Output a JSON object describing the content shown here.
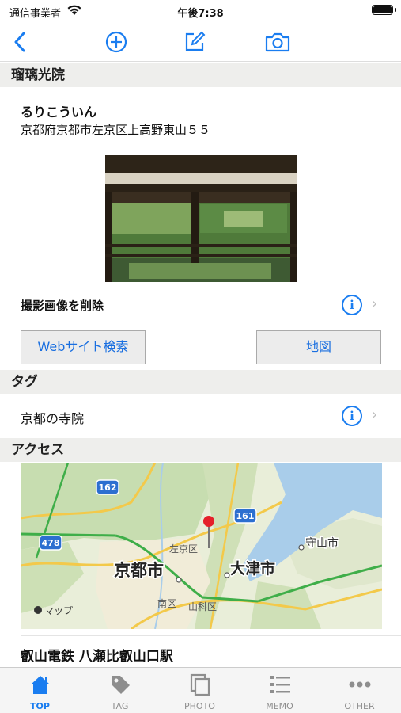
{
  "status_bar": {
    "carrier": "通信事業者",
    "time": "午後7:38"
  },
  "place": {
    "name": "瑠璃光院",
    "kana": "るりこういん",
    "address": "京都府京都市左京区上高野東山５５"
  },
  "photo_row": {
    "delete_label": "撮影画像を削除"
  },
  "buttons": {
    "web_search": "Webサイト検索",
    "map": "地図"
  },
  "tag_section": {
    "header": "タグ",
    "tag": "京都の寺院"
  },
  "access_section": {
    "header": "アクセス",
    "station": "叡山電鉄 八瀬比叡山口駅"
  },
  "map": {
    "labels": {
      "kyoto": "京都市",
      "otsu": "大津市",
      "sakyo": "左京区",
      "moriyama": "守山市",
      "minami": "南区",
      "yamashina": "山科区",
      "route162": "162",
      "route161": "161",
      "route478": "478",
      "attribution": "マップ"
    }
  },
  "tabs": [
    {
      "label": "TOP",
      "icon": "house-icon",
      "active": true
    },
    {
      "label": "TAG",
      "icon": "tag-icon",
      "active": false
    },
    {
      "label": "PHOTO",
      "icon": "photo-stack-icon",
      "active": false
    },
    {
      "label": "MEMO",
      "icon": "list-icon",
      "active": false
    },
    {
      "label": "OTHER",
      "icon": "ellipsis-icon",
      "active": false
    }
  ],
  "colors": {
    "accent": "#1a7df0",
    "section_bg": "#eeeeec",
    "pin": "#e5202a"
  }
}
